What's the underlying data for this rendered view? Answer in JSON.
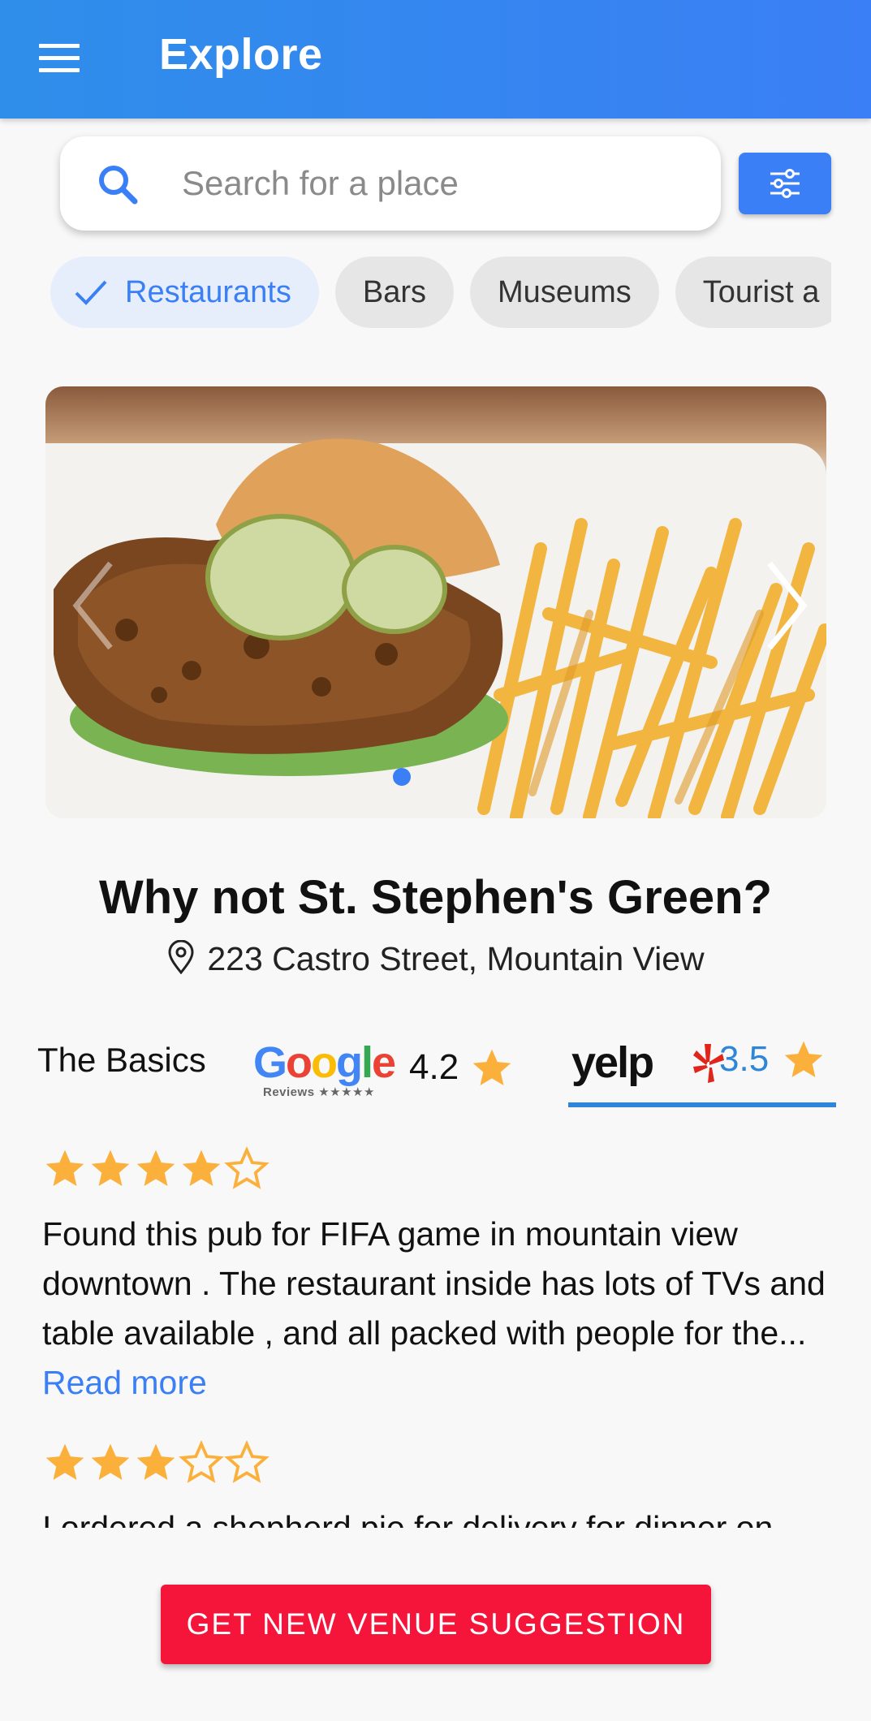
{
  "appbar": {
    "title": "Explore",
    "menu_icon": "hamburger-menu-icon"
  },
  "search": {
    "placeholder": "Search for a place",
    "icon": "search-icon",
    "filter_icon": "sliders-icon"
  },
  "chips": [
    {
      "label": "Restaurants",
      "selected": true
    },
    {
      "label": "Bars",
      "selected": false
    },
    {
      "label": "Museums",
      "selected": false
    },
    {
      "label": "Tourist a",
      "selected": false
    }
  ],
  "carousel": {
    "current_index": 0,
    "icons": [
      "chevron-left-icon",
      "chevron-right-icon"
    ]
  },
  "venue": {
    "title": "Why not St. Stephen's Green?",
    "address": "223 Castro Street, Mountain View"
  },
  "tabs": {
    "basics_label": "The Basics",
    "google": {
      "logo_text": "Google",
      "logo_subtext": "Reviews ★★★★★",
      "rating": "4.2"
    },
    "yelp": {
      "logo_text": "yelp",
      "rating": "3.5",
      "selected": true
    }
  },
  "reviews": [
    {
      "stars": 4,
      "text": "Found this pub for FIFA game in mountain view downtown . The restaurant inside has lots of TVs and table available , and all packed with people for the... ",
      "read_more": "Read more"
    },
    {
      "stars": 3,
      "text": "I ordered a shepherd pie for delivery for dinner on",
      "read_more": ""
    }
  ],
  "cta": {
    "label": "GET NEW VENUE SUGGESTION"
  },
  "colors": {
    "primary": "#3a7ff5",
    "star": "#fbb03b",
    "cta": "#f5143a",
    "yelp_underline": "#2d86d7"
  }
}
